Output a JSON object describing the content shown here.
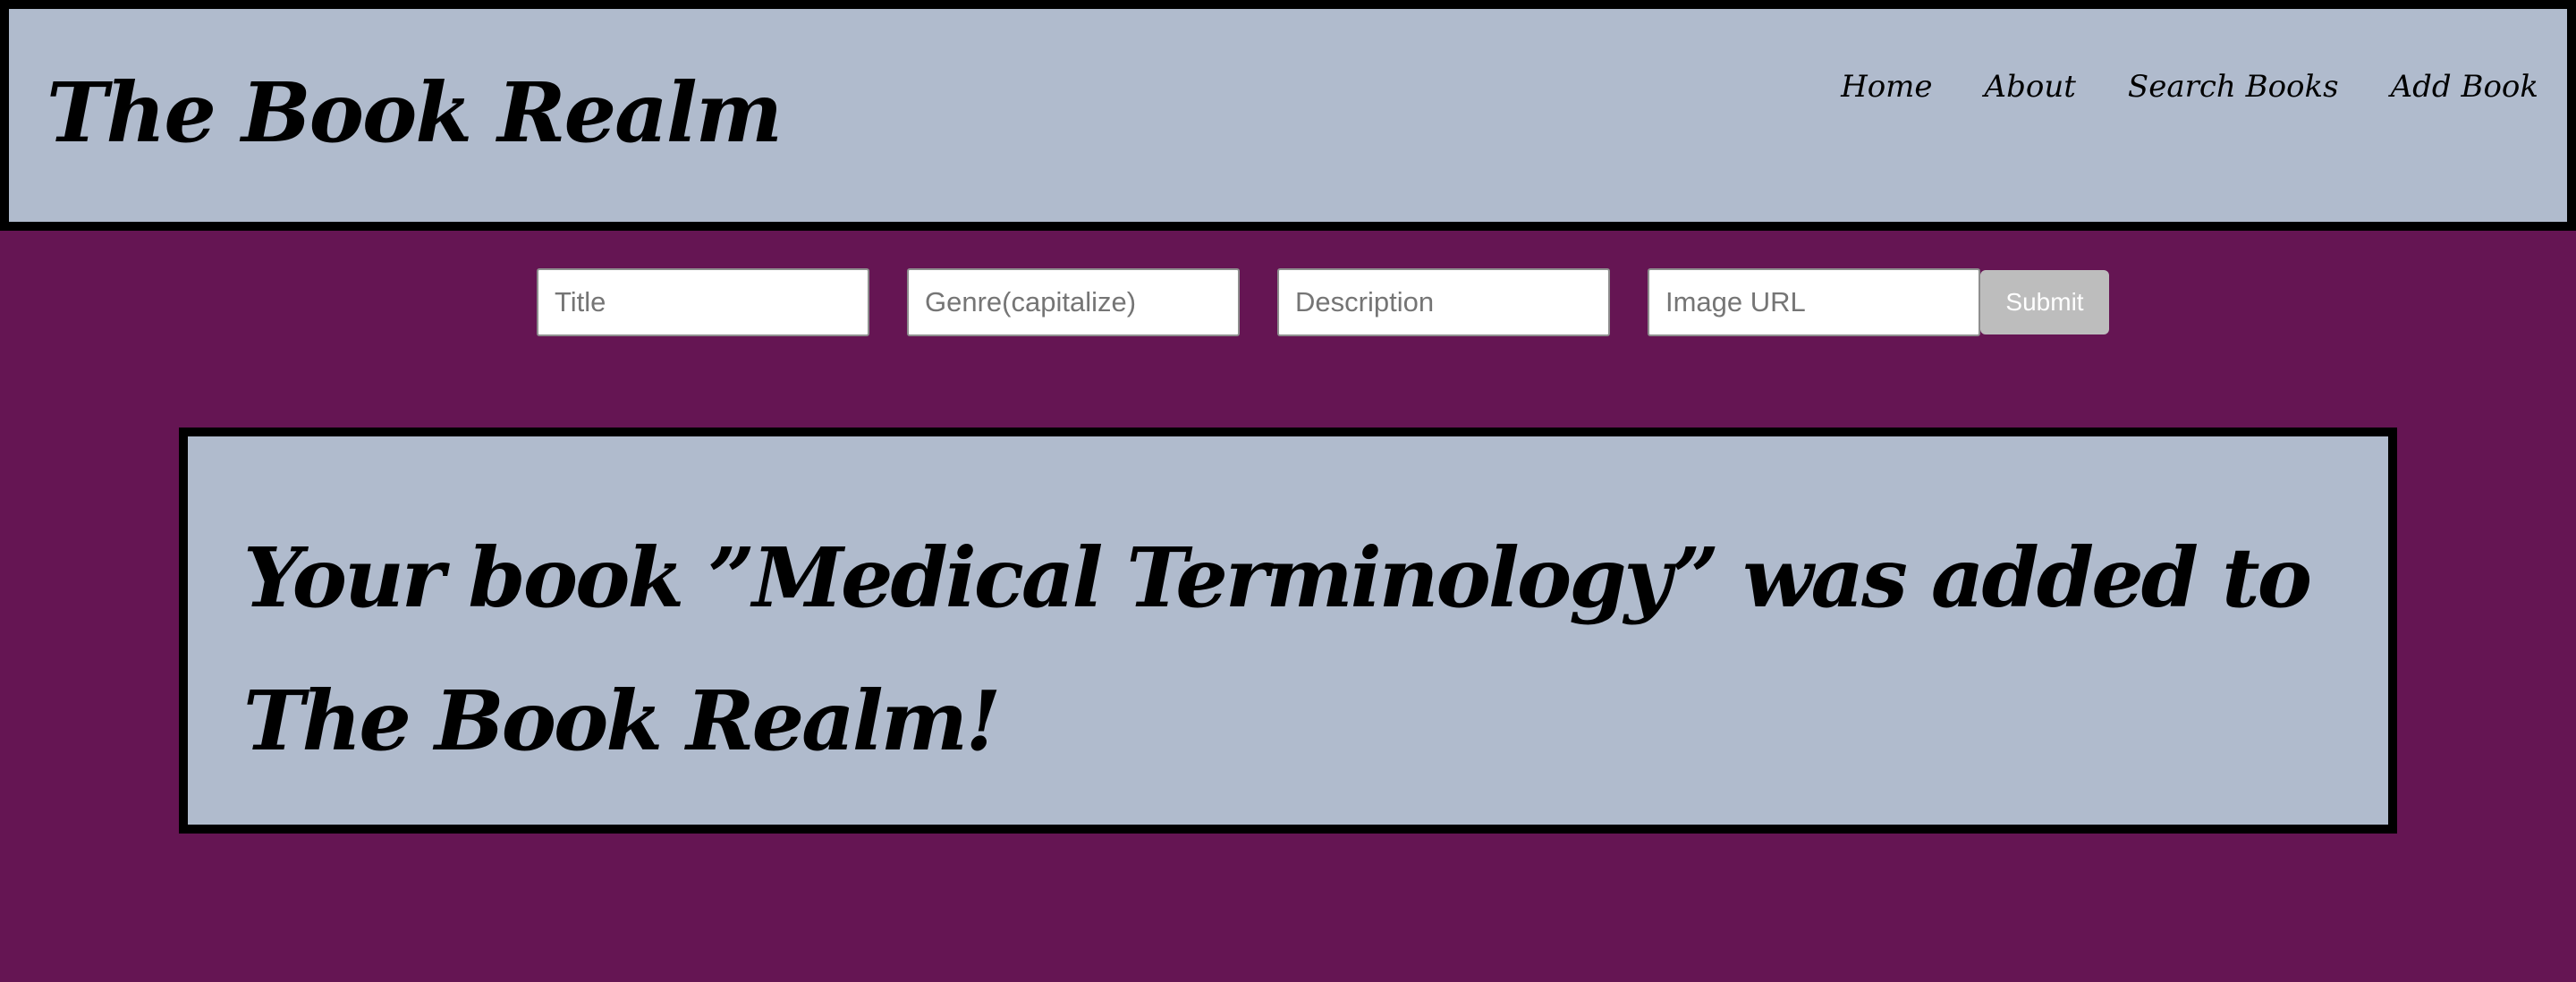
{
  "header": {
    "title": "The Book Realm",
    "nav": [
      "Home",
      "About",
      "Search Books",
      "Add Book"
    ]
  },
  "form": {
    "title_placeholder": "Title",
    "genre_placeholder": "Genre(capitalize)",
    "description_placeholder": "Description",
    "image_url_placeholder": "Image URL",
    "submit_label": "Submit"
  },
  "message": {
    "text": "Your book ”Medical Terminology” was added to The Book Realm!"
  },
  "colors": {
    "page_background": "#651553",
    "panel_background": "#b0bbcd",
    "border": "#000000",
    "submit_background": "#bdbdbd"
  }
}
